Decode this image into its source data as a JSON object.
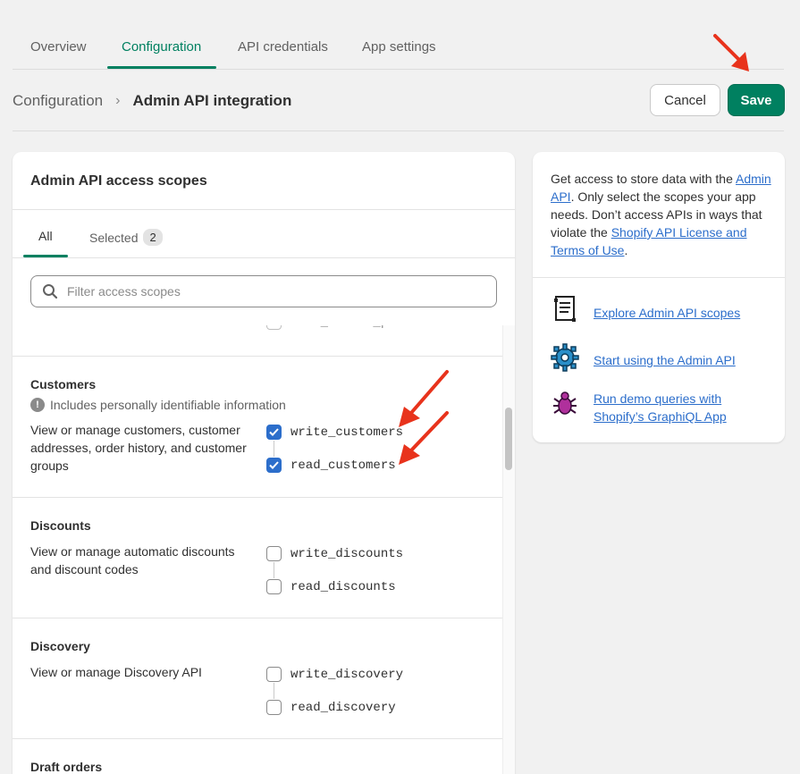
{
  "tabs": [
    "Overview",
    "Configuration",
    "API credentials",
    "App settings"
  ],
  "breadcrumb": {
    "parent": "Configuration",
    "current": "Admin API integration"
  },
  "actions": {
    "cancel": "Cancel",
    "save": "Save"
  },
  "card": {
    "title": "Admin API access scopes",
    "subtabs": {
      "all": "All",
      "selected": "Selected",
      "selected_count": "2"
    },
    "search_placeholder": "Filter access scopes",
    "peek_scope": "read_custom_pixels"
  },
  "sections": [
    {
      "title": "Customers",
      "note": "Includes personally identifiable information",
      "description": "View or manage customers, customer addresses, order history, and customer groups",
      "scopes": [
        {
          "name": "write_customers",
          "checked": true
        },
        {
          "name": "read_customers",
          "checked": true
        }
      ]
    },
    {
      "title": "Discounts",
      "description": "View or manage automatic discounts and discount codes",
      "scopes": [
        {
          "name": "write_discounts",
          "checked": false
        },
        {
          "name": "read_discounts",
          "checked": false
        }
      ]
    },
    {
      "title": "Discovery",
      "description": "View or manage Discovery API",
      "scopes": [
        {
          "name": "write_discovery",
          "checked": false
        },
        {
          "name": "read_discovery",
          "checked": false
        }
      ]
    },
    {
      "title": "Draft orders"
    }
  ],
  "side": {
    "intro_1": "Get access to store data with the ",
    "intro_link_1": "Admin API",
    "intro_2": ". Only select the scopes your app needs. Don’t access APIs in ways that violate the ",
    "intro_link_2": "Shopify API License and Terms of Use",
    "intro_3": ".",
    "resources": [
      {
        "label": "Explore Admin API scopes",
        "icon": "scroll-icon"
      },
      {
        "label": "Start using the Admin API",
        "icon": "gear-icon"
      },
      {
        "label": "Run demo queries with Shopify’s GraphiQL App",
        "icon": "bug-icon"
      }
    ]
  },
  "colors": {
    "accent": "#008060",
    "link": "#2c6ecb",
    "annotation": "#e8331c"
  }
}
